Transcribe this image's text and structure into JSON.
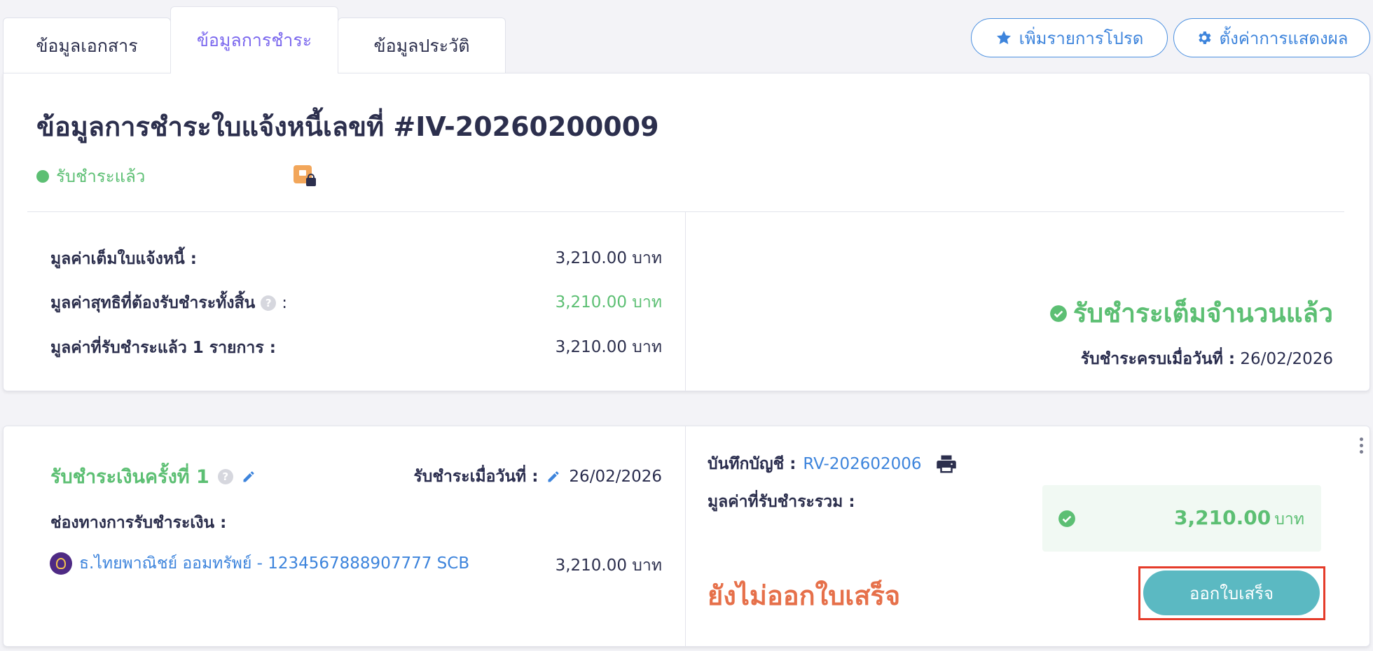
{
  "tabs": [
    {
      "label": "ข้อมูลเอกสาร"
    },
    {
      "label": "ข้อมูลการชำระ"
    },
    {
      "label": "ข้อมูลประวัติ"
    }
  ],
  "actions": {
    "favorite_label": "เพิ่มรายการโปรด",
    "settings_label": "ตั้งค่าการแสดงผล"
  },
  "summary": {
    "title": "ข้อมูลการชำระใบแจ้งหนี้เลขที่ #IV-20260200009",
    "status": "รับชำระแล้ว",
    "rows": [
      {
        "label": "มูลค่าเต็มใบแจ้งหนี้ :",
        "value": "3,210.00 บาท"
      },
      {
        "label": "มูลค่าสุทธิที่ต้องรับชำระทั้งสิ้น",
        "suffix": ":",
        "value": "3,210.00 บาท"
      },
      {
        "label": "มูลค่าที่รับชำระแล้ว 1 รายการ :",
        "value": "3,210.00 บาท"
      }
    ],
    "full_paid_text": "รับชำระเต็มจำนวนแล้ว",
    "paid_date_label": "รับชำระครบเมื่อวันที่ :",
    "paid_date": "26/02/2026"
  },
  "payment": {
    "title": "รับชำระเงินครั้งที่ 1",
    "date_label": "รับชำระเมื่อวันที่ :",
    "date": "26/02/2026",
    "channel_label": "ช่องทางการรับชำระเงิน :",
    "channel_name": "ธ.ไทยพาณิชย์ ออมทรัพย์ - 1234567888907777 SCB",
    "channel_amount": "3,210.00 บาท",
    "account_label": "บันทึกบัญชี :",
    "account_ref": "RV-202602006",
    "total_label": "มูลค่าที่รับชำระรวม :",
    "total_amount": "3,210.00",
    "total_unit": "บาท",
    "receipt_status": "ยังไม่ออกใบเสร็จ",
    "issue_receipt_label": "ออกใบเสร็จ"
  },
  "colors": {
    "accent_purple": "#7b68ee",
    "success_green": "#5cbf73",
    "link_blue": "#3d84dc",
    "warning_orange": "#e6704a",
    "button_teal": "#5bb9c2"
  }
}
